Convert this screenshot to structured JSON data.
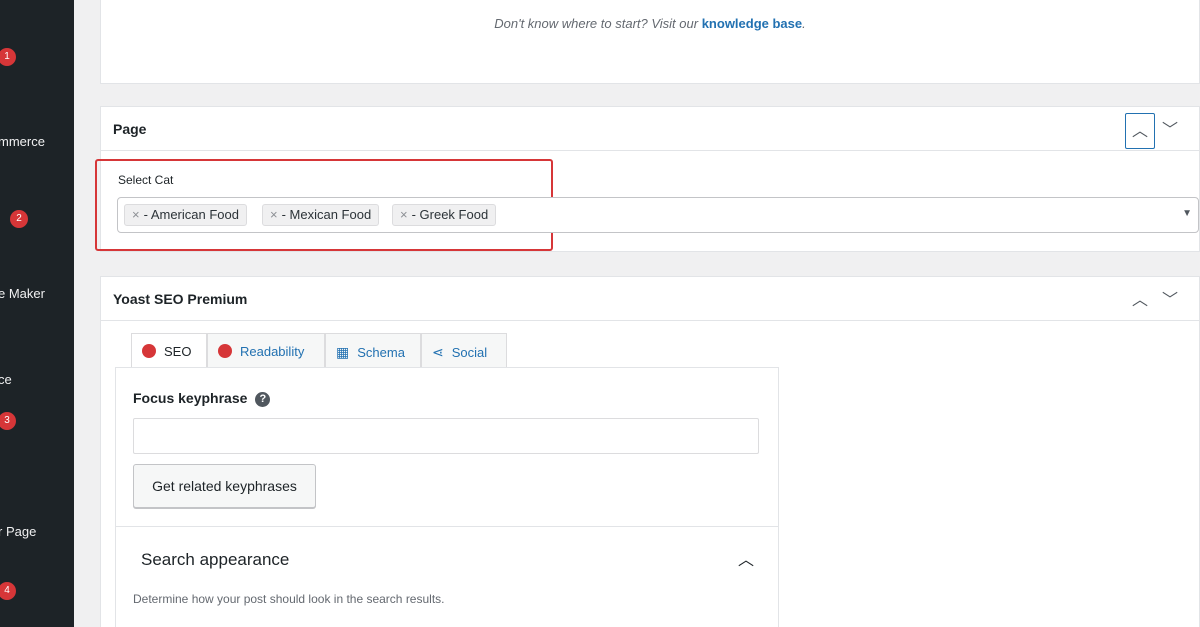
{
  "sidebar": {
    "badges": [
      "1",
      "2",
      "3",
      "4"
    ],
    "labels": [
      "mmerce",
      "e Maker",
      "ce",
      "r Page"
    ]
  },
  "top_notice": {
    "text": "Don't know where to start? Visit our",
    "link": "knowledge base"
  },
  "page_panel": {
    "title": "Page",
    "field_label": "Select Cat",
    "chips": [
      "- American Food",
      "- Mexican Food",
      "- Greek Food"
    ],
    "chip_remove": "×"
  },
  "yoast": {
    "title": "Yoast SEO Premium",
    "tabs": [
      "SEO",
      "Readability",
      "Schema",
      "Social"
    ],
    "focus_label": "Focus keyphrase",
    "focus_value": "",
    "related_button": "Get related keyphrases",
    "search_appearance": "Search appearance",
    "search_desc": "Determine how your post should look in the search results."
  },
  "colors": {
    "accent": "#2271b1",
    "error": "#d63638",
    "sidebar": "#1d2327"
  }
}
